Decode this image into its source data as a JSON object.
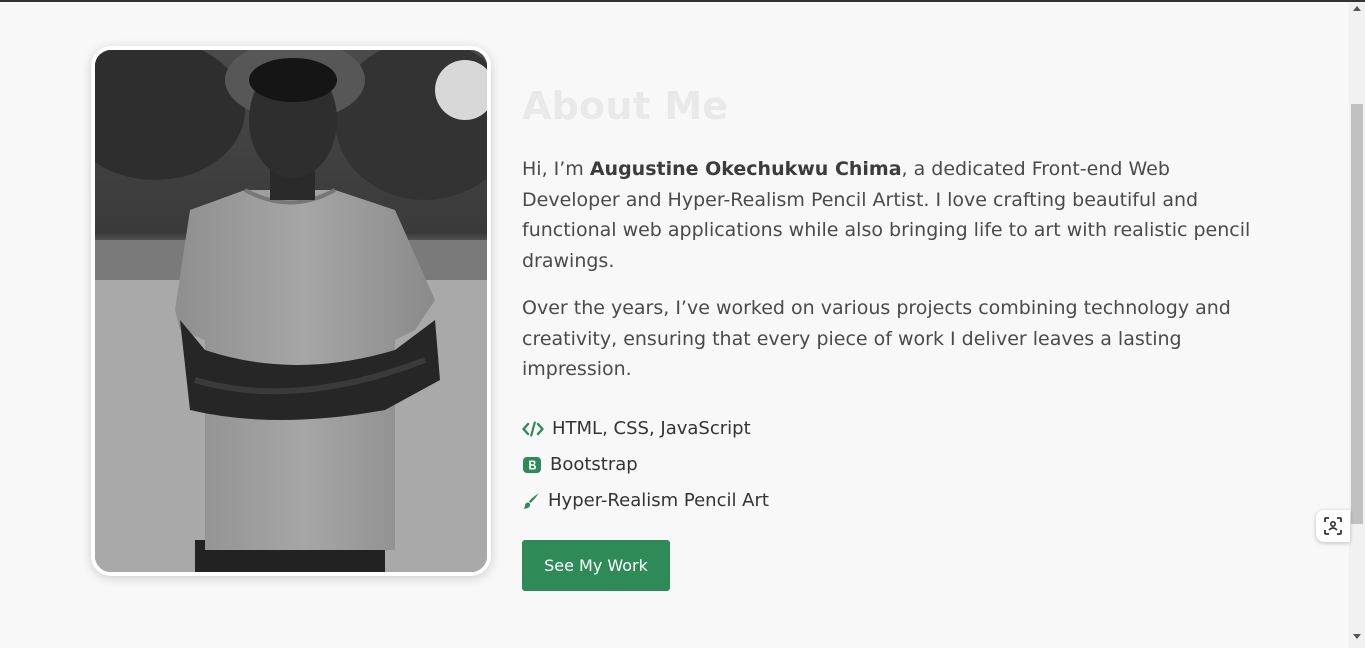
{
  "about": {
    "heading": "About Me",
    "para1_prefix": "Hi, I’m ",
    "para1_name": "Augustine Okechukwu Chima",
    "para1_suffix": ", a dedicated Front-end Web Developer and Hyper-Realism Pencil Artist. I love crafting beautiful and functional web applications while also bringing life to art with realistic pencil drawings.",
    "para2": "Over the years, I’ve worked on various projects combining technology and creativity, ensuring that every piece of work I deliver leaves a lasting impression.",
    "skills": [
      {
        "icon": "code-icon",
        "label": "HTML, CSS, JavaScript"
      },
      {
        "icon": "bootstrap-icon",
        "label": "Bootstrap"
      },
      {
        "icon": "paintbrush-icon",
        "label": "Hyper-Realism Pencil Art"
      }
    ],
    "button_label": "See My Work"
  },
  "colors": {
    "accent": "#2e8b57",
    "heading": "#e9e9e9",
    "background": "#f8f8f8"
  }
}
